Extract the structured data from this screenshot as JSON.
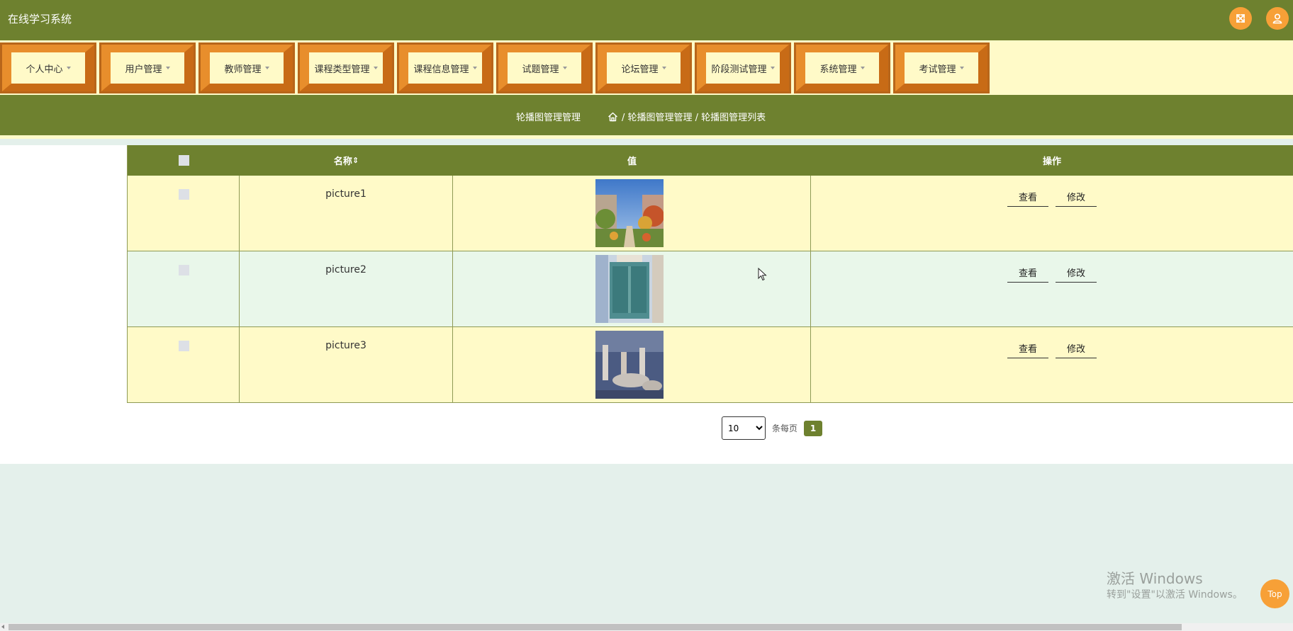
{
  "app": {
    "title": "在线学习系统"
  },
  "header": {
    "fullscreen_icon": "expand-arrows-icon",
    "user_icon": "user-icon"
  },
  "menu": {
    "items": [
      {
        "label": "个人中心"
      },
      {
        "label": "用户管理"
      },
      {
        "label": "教师管理"
      },
      {
        "label": "课程类型管理"
      },
      {
        "label": "课程信息管理"
      },
      {
        "label": "试题管理"
      },
      {
        "label": "论坛管理"
      },
      {
        "label": "阶段测试管理"
      },
      {
        "label": "系统管理"
      },
      {
        "label": "考试管理"
      }
    ]
  },
  "breadcrumb": {
    "title": "轮播图管理管理",
    "path": "/ 轮播图管理管理 / 轮播图管理列表",
    "home_icon": "home-icon"
  },
  "table": {
    "headers": {
      "name": "名称",
      "sort_arrows": "⇕",
      "value": "值",
      "actions": "操作"
    },
    "rows": [
      {
        "name": "picture1",
        "view": "查看",
        "edit": "修改"
      },
      {
        "name": "picture2",
        "view": "查看",
        "edit": "修改"
      },
      {
        "name": "picture3",
        "view": "查看",
        "edit": "修改"
      }
    ]
  },
  "pagination": {
    "page_size": "10",
    "page_size_options": [
      "10"
    ],
    "per_page_label": "条每页",
    "current_page": "1"
  },
  "watermark": {
    "line1": "激活 Windows",
    "line2": "转到\"设置\"以激活 Windows。"
  },
  "top_button": {
    "label": "Top"
  },
  "colors": {
    "primary": "#6e812f",
    "accent": "#f7a037",
    "cream": "#fffac8",
    "mint": "#e9f7ea",
    "background": "#e4f0eb"
  }
}
